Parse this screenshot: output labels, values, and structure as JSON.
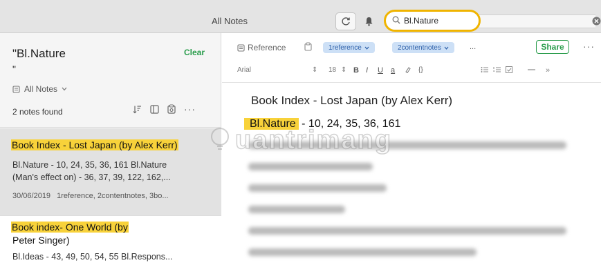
{
  "window": {
    "title": "All Notes"
  },
  "search": {
    "query": "Bl.Nature"
  },
  "sidebar": {
    "search_title": "\"Bl.Nature",
    "search_title_quote": "\"",
    "clear_label": "Clear",
    "notebook_filter": "All Notes",
    "notes_found": "2 notes found"
  },
  "notes": [
    {
      "title": "Book Index - Lost Japan (by Alex Kerr)",
      "snippet_line1": "Bl.Nature - 10, 24, 35, 36, 161 Bl.Nature",
      "snippet_line2": "(Man's effect on) - 36, 37, 39, 122, 162,...",
      "meta_date": "30/06/2019",
      "meta_tags": "1reference, 2contentnotes, 3bo..."
    },
    {
      "title_line1": "Book index- One World (by",
      "title_line2": "Peter Singer)",
      "snippet_line1": "Bl.Ideas - 43, 49, 50, 54, 55 Bl.Respons..."
    }
  ],
  "editor": {
    "notebook": "Reference",
    "tags": [
      "1reference",
      "2contentnotes"
    ],
    "tags_more": "...",
    "share_label": "Share",
    "more_label": "···",
    "font_name": "Arial",
    "font_size": "18",
    "fmt_bold": "B",
    "fmt_italic": "I",
    "fmt_underline": "U",
    "fmt_text_color": "a",
    "fmt_code": "{}",
    "fmt_expand": "»",
    "doc_title": "Book Index - Lost Japan (by Alex Kerr)",
    "doc_line1_term": "Bl.Nature",
    "doc_line1_rest": " - 10, 24, 35, 36, 161"
  },
  "colors": {
    "accent_green": "#2a9d4c",
    "highlight_yellow": "#f8d23a",
    "search_ring": "#f0b400",
    "tag_chip": "#cde0f6"
  }
}
